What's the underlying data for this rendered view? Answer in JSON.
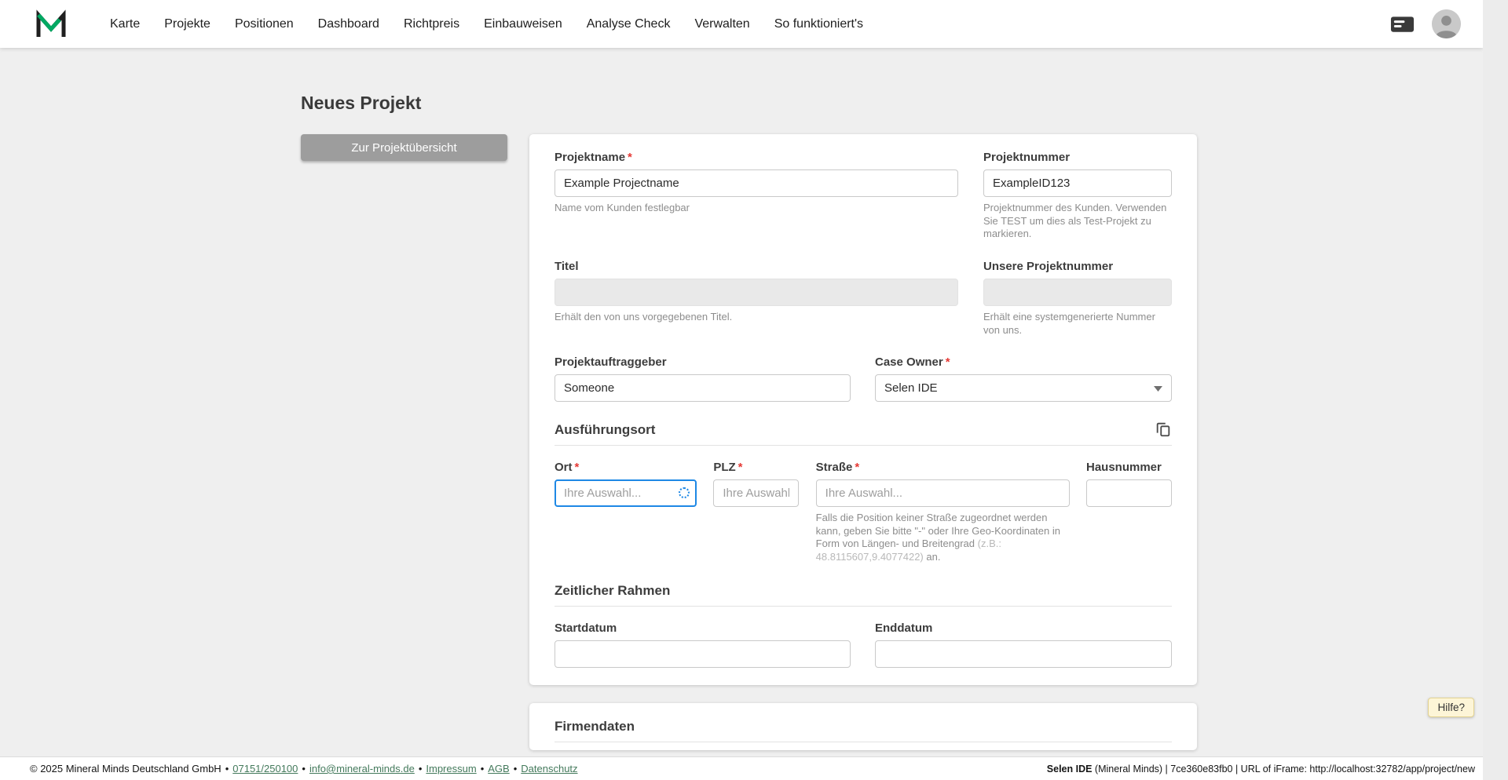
{
  "colors": {
    "brand_green": "#00a862",
    "focus_blue": "#1e88e5",
    "required_red": "#e53935",
    "help_yellow": "#fdf5d7",
    "button_gray": "#9d9d9d"
  },
  "nav": {
    "items": [
      "Karte",
      "Projekte",
      "Positionen",
      "Dashboard",
      "Richtpreis",
      "Einbauweisen",
      "Analyse Check",
      "Verwalten",
      "So funktioniert's"
    ]
  },
  "page": {
    "title": "Neues Projekt",
    "overview_button_label": "Zur Projektübersicht"
  },
  "form": {
    "required_marker": "*",
    "projektname": {
      "label": "Projektname",
      "value": "Example Projectname",
      "helper": "Name vom Kunden festlegbar"
    },
    "projektnummer": {
      "label": "Projektnummer",
      "value": "ExampleID123",
      "helper": "Projektnummer des Kunden. Verwenden Sie TEST um dies als Test-Projekt zu markieren."
    },
    "titel": {
      "label": "Titel",
      "value": "",
      "helper": "Erhält den von uns vorgegebenen Titel."
    },
    "unsere_projektnummer": {
      "label": "Unsere Projektnummer",
      "value": "",
      "helper": "Erhält eine systemgenerierte Nummer von uns."
    },
    "projektauftraggeber": {
      "label": "Projektauftraggeber",
      "value": "Someone"
    },
    "case_owner": {
      "label": "Case Owner",
      "value": "Selen IDE"
    },
    "section_ausfuehrungsort": "Ausführungsort",
    "ort": {
      "label": "Ort",
      "placeholder": "Ihre Auswahl..."
    },
    "plz": {
      "label": "PLZ",
      "placeholder": "Ihre Auswahl."
    },
    "strasse": {
      "label": "Straße",
      "placeholder": "Ihre Auswahl...",
      "helper_main": "Falls die Position keiner Straße zugeordnet werden kann, geben Sie bitte \"-\" oder Ihre Geo-Koordinaten in Form von Längen- und Breitengrad ",
      "helper_example": "(z.B.: 48.8115607,9.4077422)",
      "helper_suffix": " an."
    },
    "hausnummer": {
      "label": "Hausnummer"
    },
    "section_zeitlicher_rahmen": "Zeitlicher Rahmen",
    "startdatum": {
      "label": "Startdatum"
    },
    "enddatum": {
      "label": "Enddatum"
    },
    "section_firmendaten": "Firmendaten"
  },
  "help_button_label": "Hilfe?",
  "footer": {
    "copyright": "© 2025 Mineral Minds Deutschland GmbH",
    "separator": "•",
    "links": [
      "07151/250100",
      "info@mineral-minds.de",
      "Impressum",
      "AGB",
      "Datenschutz"
    ],
    "session_user": "Selen IDE",
    "session_rest": " (Mineral Minds) | 7ce360e83fb0 | URL of iFrame: http://localhost:32782/app/project/new"
  }
}
